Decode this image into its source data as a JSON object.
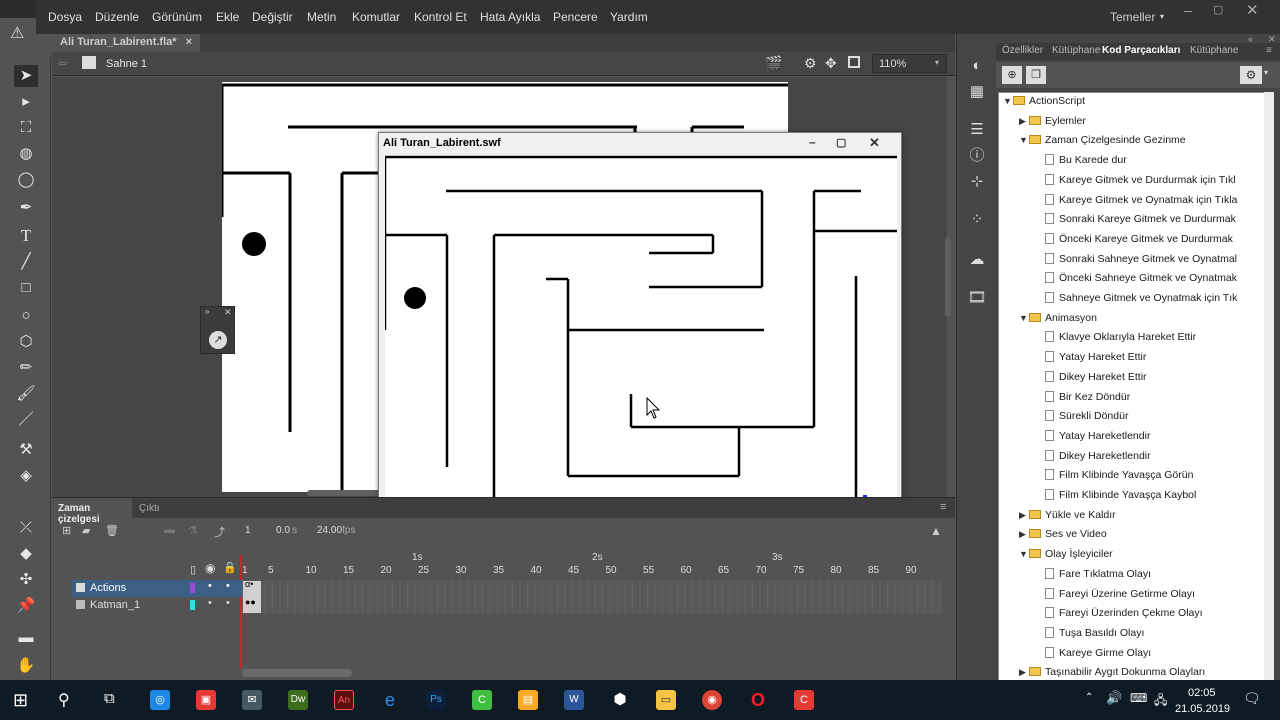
{
  "menubar": {
    "app_icon": "An",
    "items": [
      "Dosya",
      "Düzenle",
      "Görünüm",
      "Ekle",
      "Değiştir",
      "Metin",
      "Komutlar",
      "Kontrol Et",
      "Hata Ayıkla",
      "Pencere",
      "Yardım"
    ],
    "workspace": "Temeller",
    "warning_icon": "warning-icon"
  },
  "doc_tab": {
    "title": "Ali Turan_Labirent.fla*",
    "close": "×"
  },
  "edit_bar": {
    "scene": "Sahne 1",
    "zoom": "110%"
  },
  "swf": {
    "title": "Ali Turan_Labirent.swf"
  },
  "timeline": {
    "tabs": [
      "Zaman çizelgesi",
      "Çıktı"
    ],
    "frame": "1",
    "time": "0.0",
    "time_unit": "s",
    "fps": "24.00",
    "fps_unit": "fps",
    "seconds": [
      "1s",
      "2s",
      "3s"
    ],
    "frame_numbers": [
      "1",
      "5",
      "10",
      "15",
      "20",
      "25",
      "30",
      "35",
      "40",
      "45",
      "50",
      "55",
      "60",
      "65",
      "70",
      "75",
      "80",
      "85",
      "90"
    ],
    "layers": [
      {
        "name": "Actions",
        "color": "#9b4ad6"
      },
      {
        "name": "Katman_1",
        "color": "#2ee0e0"
      }
    ]
  },
  "panel": {
    "tabs": [
      "Özellikler",
      "Kütüphane",
      "Kod Parçacıkları",
      "Kütüphane"
    ],
    "tree": [
      {
        "d": 0,
        "t": "f",
        "o": true,
        "l": "ActionScript"
      },
      {
        "d": 1,
        "t": "f",
        "o": false,
        "l": "Eylemler"
      },
      {
        "d": 1,
        "t": "f",
        "o": true,
        "l": "Zaman Çizelgesinde Gezinme"
      },
      {
        "d": 2,
        "t": "d",
        "l": "Bu Karede dur"
      },
      {
        "d": 2,
        "t": "d",
        "l": "Kareye Gitmek ve Durdurmak için Tıkl"
      },
      {
        "d": 2,
        "t": "d",
        "l": "Kareye Gitmek ve Oynatmak için Tıkla"
      },
      {
        "d": 2,
        "t": "d",
        "l": "Sonraki Kareye Gitmek ve Durdurmak"
      },
      {
        "d": 2,
        "t": "d",
        "l": "Önceki Kareye Gitmek ve Durdurmak"
      },
      {
        "d": 2,
        "t": "d",
        "l": "Sonraki Sahneye Gitmek ve Oynatmal"
      },
      {
        "d": 2,
        "t": "d",
        "l": "Önceki Sahneye Gitmek ve Oynatmak"
      },
      {
        "d": 2,
        "t": "d",
        "l": "Sahneye Gitmek ve Oynatmak için Tık"
      },
      {
        "d": 1,
        "t": "f",
        "o": true,
        "l": "Animasyon"
      },
      {
        "d": 2,
        "t": "d",
        "l": "Klavye Oklarıyla Hareket Ettir"
      },
      {
        "d": 2,
        "t": "d",
        "l": "Yatay Hareket Ettir"
      },
      {
        "d": 2,
        "t": "d",
        "l": "Dikey Hareket Ettir"
      },
      {
        "d": 2,
        "t": "d",
        "l": "Bir Kez Döndür"
      },
      {
        "d": 2,
        "t": "d",
        "l": "Sürekli Döndür"
      },
      {
        "d": 2,
        "t": "d",
        "l": "Yatay Hareketlendir"
      },
      {
        "d": 2,
        "t": "d",
        "l": "Dikey Hareketlendir"
      },
      {
        "d": 2,
        "t": "d",
        "l": "Film Klibinde Yavaşça Görün"
      },
      {
        "d": 2,
        "t": "d",
        "l": "Film Klibinde Yavaşça Kaybol"
      },
      {
        "d": 1,
        "t": "f",
        "o": false,
        "l": "Yükle ve Kaldır"
      },
      {
        "d": 1,
        "t": "f",
        "o": false,
        "l": "Ses ve Video"
      },
      {
        "d": 1,
        "t": "f",
        "o": true,
        "l": "Olay İşleyiciler"
      },
      {
        "d": 2,
        "t": "d",
        "l": "Fare Tıklatma Olayı"
      },
      {
        "d": 2,
        "t": "d",
        "l": "Fareyi Üzerine Getirme Olayı"
      },
      {
        "d": 2,
        "t": "d",
        "l": "Fareyi Üzerinden Çekme Olayı"
      },
      {
        "d": 2,
        "t": "d",
        "l": "Tuşa Basıldı Olayı"
      },
      {
        "d": 2,
        "t": "d",
        "l": "Kareye Girme Olayı"
      },
      {
        "d": 1,
        "t": "f",
        "o": false,
        "l": "Taşınabilir Aygıt Dokunma Olayları"
      }
    ]
  },
  "taskbar": {
    "time": "02:05",
    "date": "21.05.2019"
  },
  "colors": {
    "accent": "#3c5f85",
    "goal_flag": "#f5c400",
    "goal_post": "#1a2fd4"
  }
}
